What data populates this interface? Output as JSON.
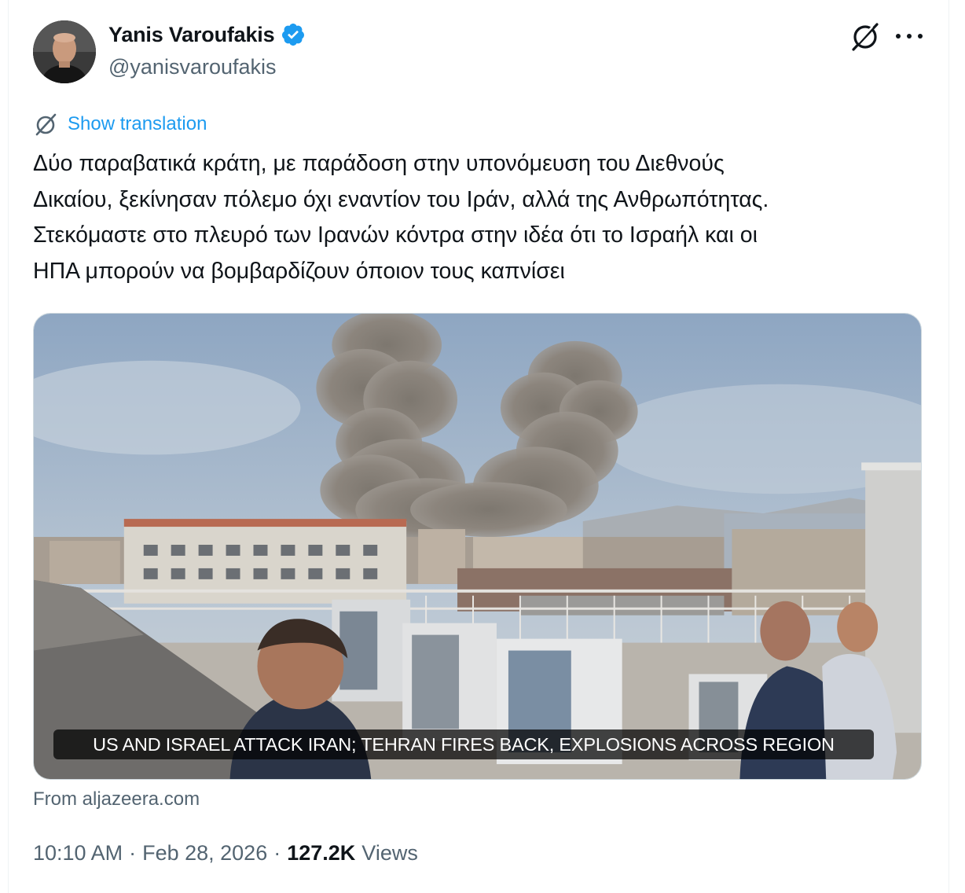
{
  "author": {
    "name": "Yanis Varoufakis",
    "handle": "@yanisvaroufakis",
    "verified": true,
    "avatar_icon": "profile-photo"
  },
  "header_icons": [
    "grok-icon",
    "more-icon"
  ],
  "translation": {
    "icon": "translate-icon",
    "label": "Show translation"
  },
  "tweet": {
    "lines": [
      "Δύο παραβατικά κράτη, με παράδοση στην υπονόμευση του Διεθνούς",
      "Δικαίου, ξεκίνησαν πόλεμο όχι εναντίον του Ιράν, αλλά της Ανθρωπότητας.",
      "Στεκόμαστε στο πλευρό των Ιρανών κόντρα στην ιδέα ότι το Ισραήλ και οι",
      "ΗΠΑ μπορούν να βομβαρδίζουν όποιον τους καπνίσει"
    ]
  },
  "media": {
    "headline": "US AND ISRAEL ATTACK IRAN; TEHRAN FIRES BACK, EXPLOSIONS ACROSS REGION",
    "source": "From aljazeera.com"
  },
  "meta": {
    "time": "10:10 AM",
    "separator": "·",
    "date": "Feb 28, 2026",
    "views_count": "127.2K",
    "views_label": "Views"
  },
  "colors": {
    "link": "#1d9bf0",
    "secondary_text": "#536471",
    "verified_badge": "#1d9bf0"
  }
}
